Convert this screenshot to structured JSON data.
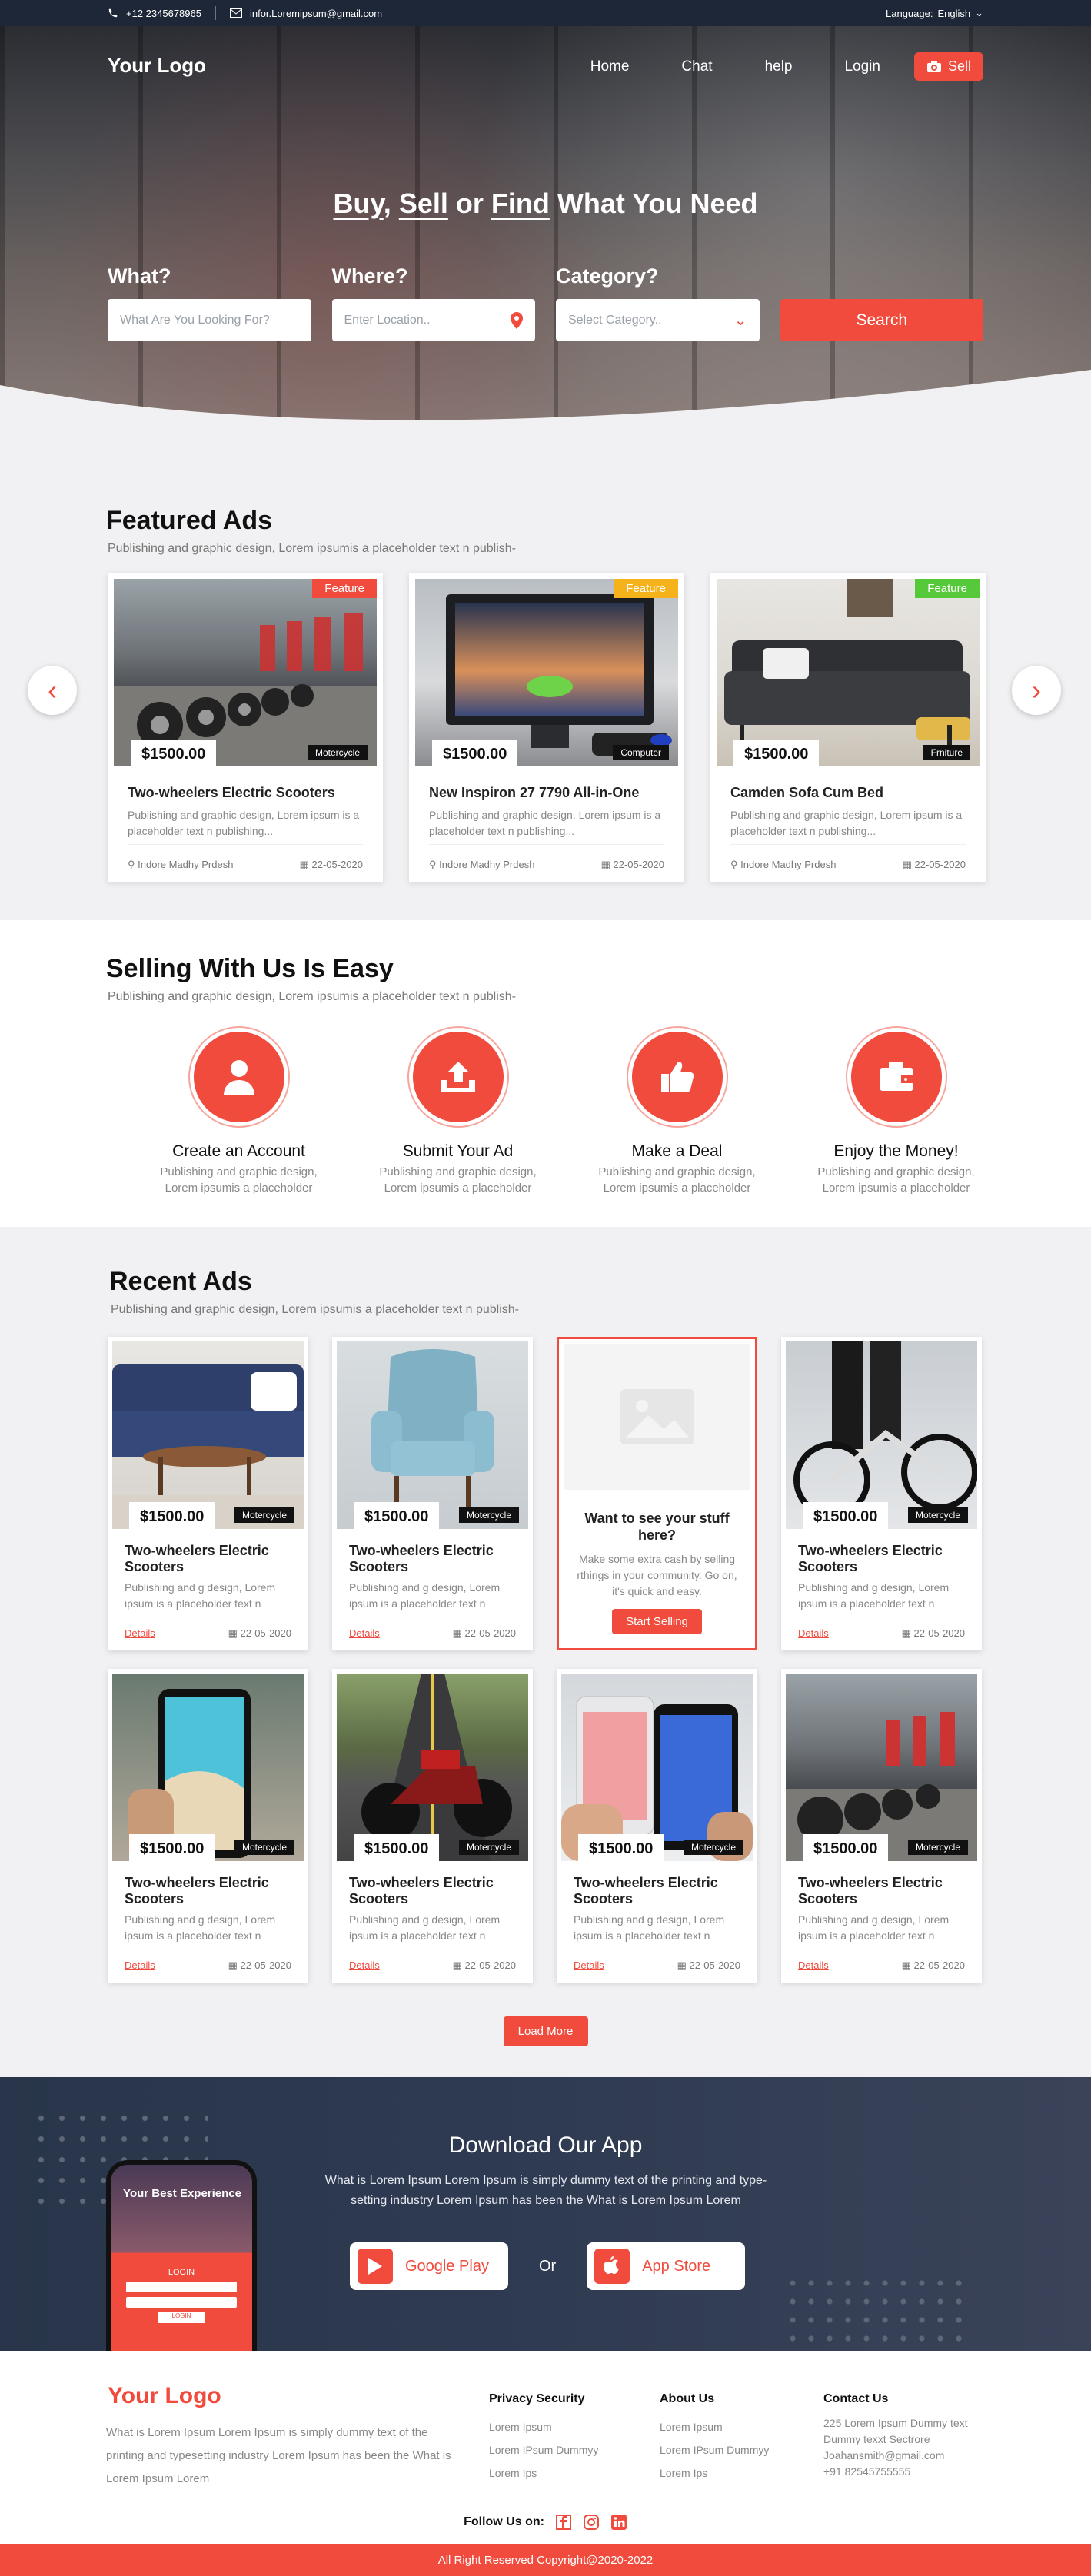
{
  "topbar": {
    "phone": "+12 2345678965",
    "email": "infor.Loremipsum@gmail.com",
    "language_label": "Language:",
    "language_value": "English"
  },
  "nav": {
    "logo": "Your Logo",
    "links": [
      "Home",
      "Chat",
      "help",
      "Login"
    ],
    "sell": "Sell"
  },
  "hero": {
    "headline_parts": [
      "Buy",
      ", ",
      "Sell",
      " or ",
      "Find",
      " What You Need"
    ],
    "what_label": "What?",
    "what_placeholder": "What Are You Looking For?",
    "where_label": "Where?",
    "where_placeholder": "Enter Location..",
    "category_label": "Category?",
    "category_placeholder": "Select Category..",
    "search_button": "Search"
  },
  "featured": {
    "title": "Featured Ads",
    "subtitle": "Publishing and graphic design, Lorem ipsumis a placeholder text n publish-",
    "cards": [
      {
        "ribbon": "Feature",
        "ribbon_color": "#f04b3d",
        "price": "$1500.00",
        "category": "Motercycle",
        "title": "Two-wheelers Electric Scooters",
        "desc": "Publishing and graphic design, Lorem ipsum is a placeholder text n publishing...",
        "location": "Indore Madhy Prdesh",
        "date": "22-05-2020"
      },
      {
        "ribbon": "Feature",
        "ribbon_color": "#f5b21b",
        "price": "$1500.00",
        "category": "Computer",
        "title": "New Inspiron 27 7790 All-in-One",
        "desc": "Publishing and graphic design, Lorem ipsum is a placeholder text n publishing...",
        "location": "Indore Madhy Prdesh",
        "date": "22-05-2020"
      },
      {
        "ribbon": "Feature",
        "ribbon_color": "#55c93a",
        "price": "$1500.00",
        "category": "Frniture",
        "title": "Camden Sofa Cum Bed",
        "desc": "Publishing and graphic design, Lorem ipsum is a placeholder text n publishing...",
        "location": "Indore Madhy Prdesh",
        "date": "22-05-2020"
      }
    ]
  },
  "selling": {
    "title": "Selling With Us Is Easy",
    "subtitle": "Publishing and graphic design, Lorem ipsumis a placeholder text n publish-",
    "steps": [
      {
        "icon": "user-icon",
        "title": "Create an Account",
        "desc": "Publishing and graphic design, Lorem ipsumis a placeholder"
      },
      {
        "icon": "upload-icon",
        "title": "Submit Your Ad",
        "desc": "Publishing and graphic design, Lorem ipsumis a placeholder"
      },
      {
        "icon": "thumbs-up-icon",
        "title": "Make a Deal",
        "desc": "Publishing and graphic design, Lorem ipsumis a placeholder"
      },
      {
        "icon": "wallet-icon",
        "title": "Enjoy the Money!",
        "desc": "Publishing and graphic design, Lorem ipsumis a placeholder"
      }
    ]
  },
  "recent": {
    "title": "Recent Ads",
    "subtitle": "Publishing and graphic design, Lorem ipsumis a placeholder text n publish-",
    "cards": [
      {
        "price": "$1500.00",
        "category": "Motercycle",
        "title": "Two-wheelers Electric Scooters",
        "desc": "Publishing and g design, Lorem ipsum is a placeholder text n",
        "details": "Details",
        "date": "22-05-2020"
      },
      {
        "price": "$1500.00",
        "category": "Motercycle",
        "title": "Two-wheelers Electric Scooters",
        "desc": "Publishing and g design, Lorem ipsum is a placeholder text n",
        "details": "Details",
        "date": "22-05-2020"
      },
      {
        "price": "$1500.00",
        "category": "Motercycle",
        "title": "Two-wheelers Electric Scooters",
        "desc": "Publishing and g design, Lorem ipsum is a placeholder text n",
        "details": "Details",
        "date": "22-05-2020"
      },
      {
        "price": "$1500.00",
        "category": "Motercycle",
        "title": "Two-wheelers Electric Scooters",
        "desc": "Publishing and g design, Lorem ipsum is a placeholder text n",
        "details": "Details",
        "date": "22-05-2020"
      },
      {
        "price": "$1500.00",
        "category": "Motercycle",
        "title": "Two-wheelers Electric Scooters",
        "desc": "Publishing and g design, Lorem ipsum is a placeholder text n",
        "details": "Details",
        "date": "22-05-2020"
      },
      {
        "price": "$1500.00",
        "category": "Motercycle",
        "title": "Two-wheelers Electric Scooters",
        "desc": "Publishing and g design, Lorem ipsum is a placeholder text n",
        "details": "Details",
        "date": "22-05-2020"
      },
      {
        "price": "$1500.00",
        "category": "Motercycle",
        "title": "Two-wheelers Electric Scooters",
        "desc": "Publishing and g design, Lorem ipsum is a placeholder text n",
        "details": "Details",
        "date": "22-05-2020"
      }
    ],
    "promo": {
      "title": "Want to see your stuff here?",
      "desc": "Make some extra cash by selling rthings in your community. Go on, it's quick and easy.",
      "button": "Start Selling"
    },
    "load_more": "Load More"
  },
  "app": {
    "title": "Download Our App",
    "desc": "What is Lorem Ipsum Lorem Ipsum is simply dummy text of the printing and type-setting industry Lorem Ipsum has been the What is Lorem Ipsum Lorem",
    "google_play": "Google Play",
    "or": "Or",
    "app_store": "App Store",
    "phone_title": "Your Best Experience",
    "phone_login": "LOGIN",
    "phone_login_btn": "LOGIN"
  },
  "footer": {
    "logo": "Your Logo",
    "about": "What is Lorem Ipsum Lorem Ipsum is simply dummy text of the printing and typesetting industry Lorem Ipsum has been the What is Lorem Ipsum Lorem",
    "privacy_title": "Privacy Security",
    "privacy_links": [
      "Lorem Ipsum",
      "Lorem IPsum  Dummyy",
      "Lorem Ips"
    ],
    "about_title": "About Us",
    "about_links": [
      "Lorem Ipsum",
      "Lorem IPsum  Dummyy",
      "Lorem Ips"
    ],
    "contact_title": "Contact Us",
    "contact_address": "225 Lorem Ipsum Dummy text Dummy texxt Sectrore",
    "contact_email": "Joahansmith@gmail.com",
    "contact_phone": "+91 82545755555",
    "follow": "Follow Us on:",
    "copyright": "All Right Reserved Copyright@2020-2022"
  }
}
